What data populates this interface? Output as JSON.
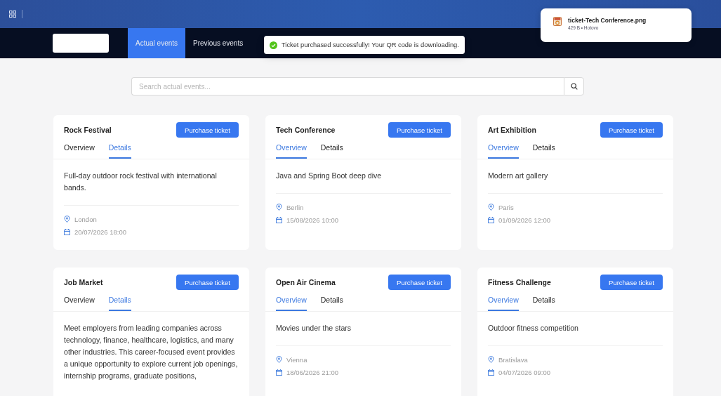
{
  "download": {
    "filename": "ticket-Tech Conference.png",
    "meta": "429 B • Hotovo"
  },
  "nav": {
    "tabs": [
      {
        "label": "Actual events",
        "selected": true
      },
      {
        "label": "Previous events",
        "selected": false
      }
    ]
  },
  "toast": {
    "message": "Ticket purchased successfully! Your QR code is downloading."
  },
  "search": {
    "placeholder": "Search actual events..."
  },
  "events": [
    {
      "title": "Rock Festival",
      "button": "Purchase ticket",
      "tabs": [
        {
          "label": "Overview",
          "selected": false
        },
        {
          "label": "Details",
          "selected": true
        }
      ],
      "description": "Full-day outdoor rock festival with international bands.",
      "location": "London",
      "date": "20/07/2026 18:00"
    },
    {
      "title": "Tech Conference",
      "button": "Purchase ticket",
      "tabs": [
        {
          "label": "Overview",
          "selected": true
        },
        {
          "label": "Details",
          "selected": false
        }
      ],
      "description": "Java and Spring Boot deep dive",
      "location": "Berlin",
      "date": "15/08/2026 10:00"
    },
    {
      "title": "Art Exhibition",
      "button": "Purchase ticket",
      "tabs": [
        {
          "label": "Overview",
          "selected": true
        },
        {
          "label": "Details",
          "selected": false
        }
      ],
      "description": "Modern art gallery",
      "location": "Paris",
      "date": "01/09/2026 12:00"
    },
    {
      "title": "Job Market",
      "button": "Purchase ticket",
      "tabs": [
        {
          "label": "Overview",
          "selected": false
        },
        {
          "label": "Details",
          "selected": true
        }
      ],
      "description": "Meet employers from leading companies across technology, finance, healthcare, logistics, and many other industries. This career-focused event provides a unique opportunity to explore current job openings, internship programs, graduate positions,"
    },
    {
      "title": "Open Air Cinema",
      "button": "Purchase ticket",
      "tabs": [
        {
          "label": "Overview",
          "selected": true
        },
        {
          "label": "Details",
          "selected": false
        }
      ],
      "description": "Movies under the stars",
      "location": "Vienna",
      "date": "18/06/2026 21:00"
    },
    {
      "title": "Fitness Challenge",
      "button": "Purchase ticket",
      "tabs": [
        {
          "label": "Overview",
          "selected": true
        },
        {
          "label": "Details",
          "selected": false
        }
      ],
      "description": "Outdoor fitness competition",
      "location": "Bratislava",
      "date": "04/07/2026 09:00"
    }
  ]
}
